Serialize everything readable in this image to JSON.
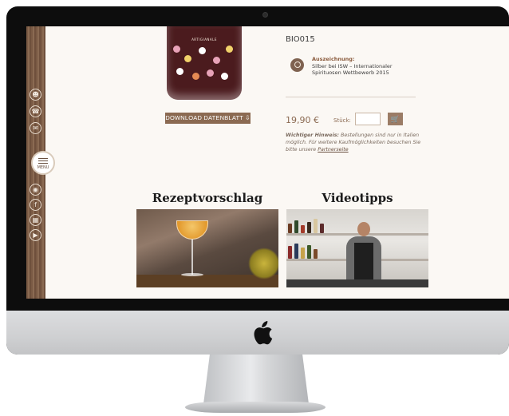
{
  "product": {
    "code": "BIO015",
    "bottle_label": "ARTIGIANALE",
    "download_button": "DOWNLOAD DATENBLATT",
    "award": {
      "title": "Auszeichnung:",
      "text": "Silber bei ISW – Internationaler Spirituosen Wettbewerb 2015"
    },
    "price": "19,90 €",
    "quantity_label": "Stück:",
    "quantity_value": "",
    "notice_bold": "Wichtiger Hinweis:",
    "notice_text": "Bestellungen sind nur in Italien möglich. Für weitere Kaufmöglichkeiten besuchen Sie bitte unsere",
    "notice_link": "Partnerseite"
  },
  "sidebar": {
    "menu_label": "MENU",
    "icons": [
      "user-icon",
      "phone-icon",
      "mail-icon",
      "instagram-icon",
      "facebook-icon",
      "blog-icon",
      "youtube-icon"
    ]
  },
  "sections": {
    "recipe_title": "Rezeptvorschlag",
    "video_title": "Videotipps"
  },
  "colors": {
    "brand_brown": "#8b6a52",
    "sidebar_wood": "#7a5a44",
    "page_bg": "#fbf8f4"
  }
}
